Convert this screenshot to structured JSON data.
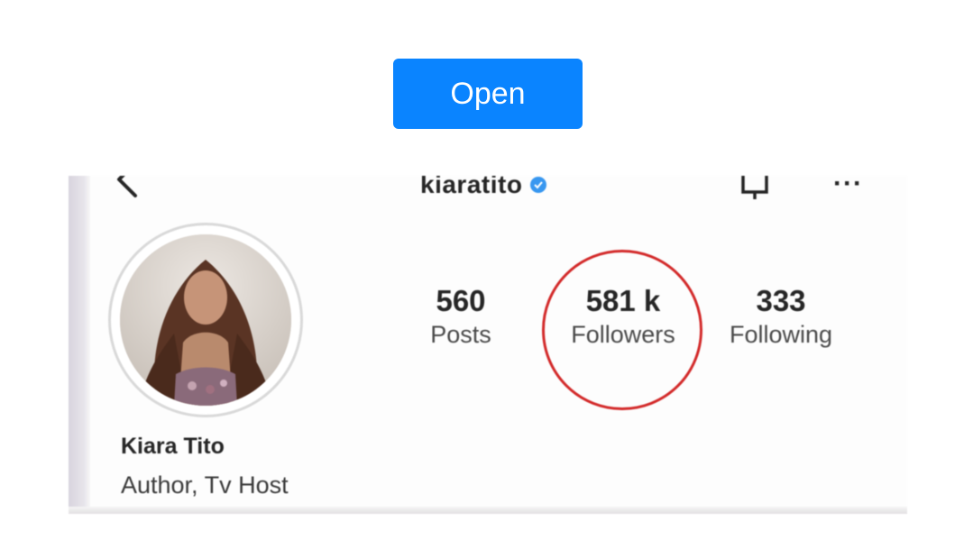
{
  "open_button": {
    "label": "Open",
    "color": "#0a84ff"
  },
  "profile": {
    "username": "kiaratito",
    "verified": true,
    "display_name": "Kiara Tito",
    "bio": "Author, Tv Host",
    "stats": [
      {
        "value": "560",
        "label": "Posts"
      },
      {
        "value": "581 k",
        "label": "Followers"
      },
      {
        "value": "333",
        "label": "Following"
      }
    ],
    "highlighted_stat": "Followers",
    "highlight_color": "#d32a2a",
    "verified_color": "#3897f0"
  },
  "icons": {
    "back": "back-arrow-icon",
    "verified": "verified-badge-icon",
    "notifications": "bell-icon",
    "more": "more-options-icon"
  }
}
